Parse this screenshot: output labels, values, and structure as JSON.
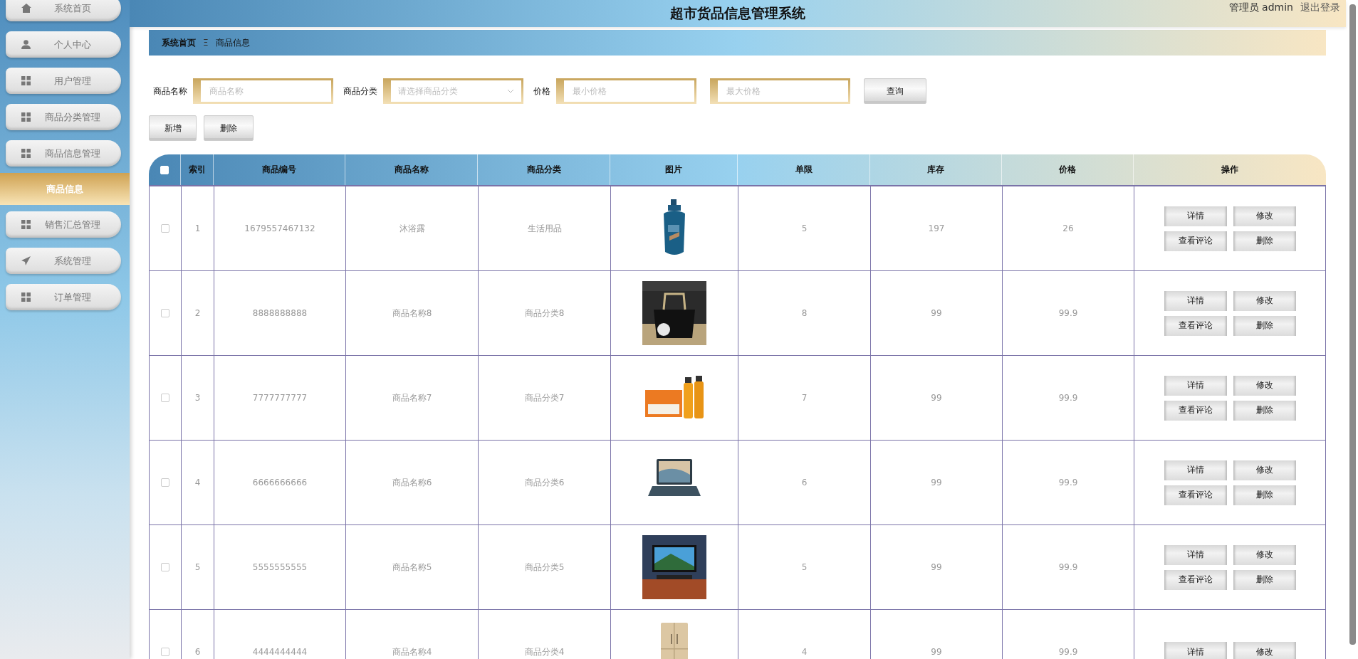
{
  "header": {
    "title": "超市货品信息管理系统",
    "user_role": "管理员 admin",
    "logout": "退出登录"
  },
  "sidebar": {
    "items": [
      {
        "label": "系统首页",
        "selected": false
      },
      {
        "label": "个人中心",
        "selected": false
      },
      {
        "label": "用户管理",
        "selected": false
      },
      {
        "label": "商品分类管理",
        "selected": false
      },
      {
        "label": "商品信息管理",
        "selected": false,
        "children": [
          {
            "label": "商品信息",
            "selected": true
          }
        ]
      },
      {
        "label": "销售汇总管理",
        "selected": false
      },
      {
        "label": "系统管理",
        "selected": false
      },
      {
        "label": "订单管理",
        "selected": false
      }
    ]
  },
  "breadcrumb": [
    "系统首页",
    "商品信息"
  ],
  "breadcrumb_separator": "Ξ",
  "search": {
    "name_label": "商品名称",
    "name_placeholder": "商品名称",
    "category_label": "商品分类",
    "category_placeholder": "请选择商品分类",
    "price_label": "价格",
    "min_placeholder": "最小价格",
    "max_placeholder": "最大价格",
    "query_button": "查询"
  },
  "actions": [
    "新增",
    "删除"
  ],
  "table": {
    "select_all_checked": false,
    "columns": [
      "索引",
      "商品编号",
      "商品名称",
      "商品分类",
      "图片",
      "单限",
      "库存",
      "价格",
      "操作"
    ],
    "rows": [
      {
        "checked": false,
        "index": "1",
        "code": "1679557467132",
        "name": "沐浴露",
        "category": "生活用品",
        "limit": "5",
        "stock": "197",
        "price": "26",
        "buttons": [
          "详情",
          "修改",
          "查看评论",
          "删除"
        ]
      },
      {
        "checked": false,
        "index": "2",
        "code": "8888888888",
        "name": "商品名称8",
        "category": "商品分类8",
        "limit": "8",
        "stock": "99",
        "price": "99.9",
        "buttons": [
          "详情",
          "修改",
          "查看评论",
          "删除"
        ]
      },
      {
        "checked": false,
        "index": "3",
        "code": "7777777777",
        "name": "商品名称7",
        "category": "商品分类7",
        "limit": "7",
        "stock": "99",
        "price": "99.9",
        "buttons": [
          "详情",
          "修改",
          "查看评论",
          "删除"
        ]
      },
      {
        "checked": false,
        "index": "4",
        "code": "6666666666",
        "name": "商品名称6",
        "category": "商品分类6",
        "limit": "6",
        "stock": "99",
        "price": "99.9",
        "buttons": [
          "详情",
          "修改",
          "查看评论",
          "删除"
        ]
      },
      {
        "checked": false,
        "index": "5",
        "code": "5555555555",
        "name": "商品名称5",
        "category": "商品分类5",
        "limit": "5",
        "stock": "99",
        "price": "99.9",
        "buttons": [
          "详情",
          "修改",
          "查看评论",
          "删除"
        ]
      },
      {
        "checked": false,
        "index": "6",
        "code": "4444444444",
        "name": "商品名称4",
        "category": "商品分类4",
        "limit": "4",
        "stock": "99",
        "price": "99.9",
        "buttons": [
          "详情",
          "修改"
        ]
      }
    ]
  }
}
